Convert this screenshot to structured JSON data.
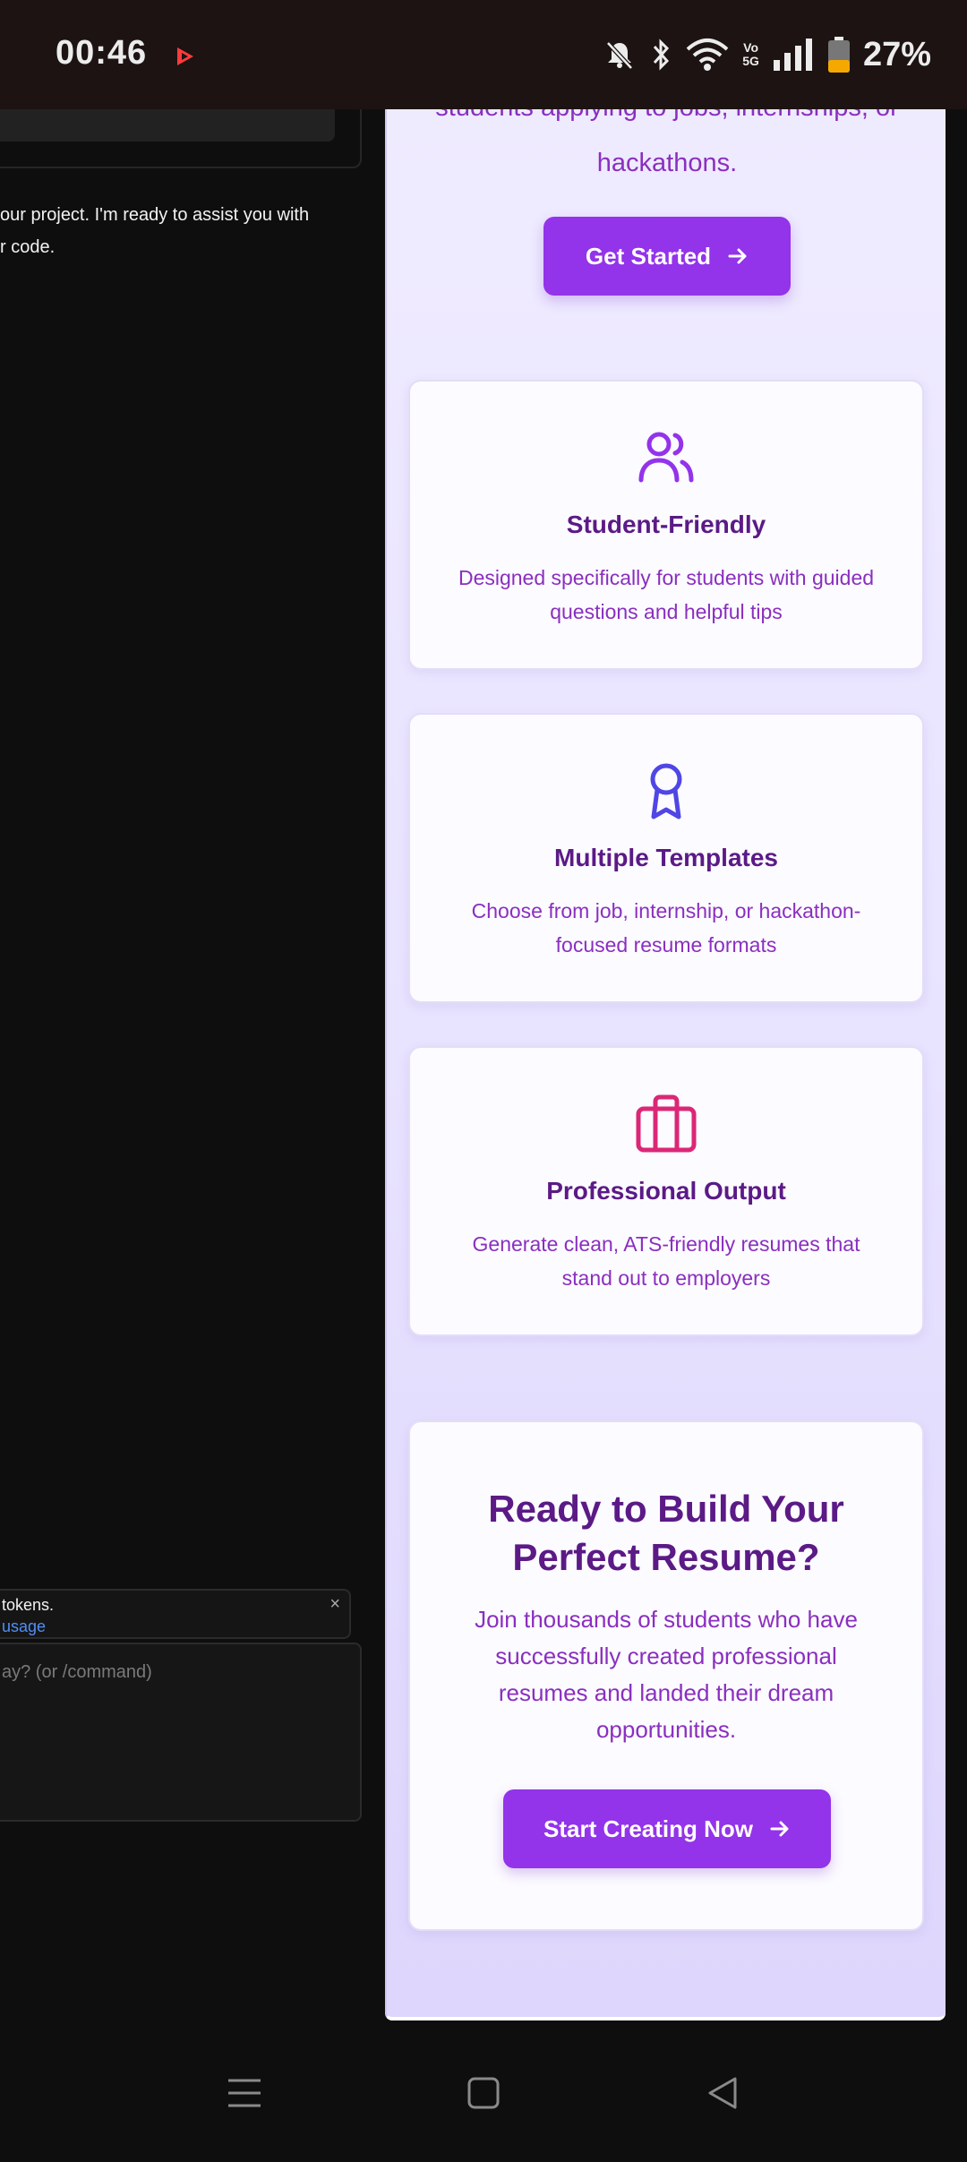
{
  "status_bar": {
    "time": "00:46",
    "battery_percent": "27%",
    "network_label_top": "Vo",
    "network_label_bottom": "5G",
    "icons": [
      "youtube-icon",
      "mute-icon",
      "bluetooth-icon",
      "wifi-icon",
      "signal-icon",
      "battery-icon"
    ]
  },
  "editor": {
    "assistant_message_line1": "our project. I'm ready to assist you with",
    "assistant_message_line2": "r code.",
    "notice_text": "tokens.",
    "notice_link": "usage",
    "notice_close": "×",
    "chat_placeholder": "ay? (or /command)"
  },
  "preview": {
    "hero_subtitle_line1": "students applying to jobs, internships, or",
    "hero_subtitle_line2": "hackathons.",
    "get_started_label": "Get Started",
    "features": [
      {
        "icon": "users-icon",
        "icon_color": "#9333ea",
        "title": "Student-Friendly",
        "description": "Designed specifically for students with guided questions and helpful tips"
      },
      {
        "icon": "award-icon",
        "icon_color": "#4f46e5",
        "title": "Multiple Templates",
        "description": "Choose from job, internship, or hackathon-focused resume formats"
      },
      {
        "icon": "briefcase-icon",
        "icon_color": "#db2777",
        "title": "Professional Output",
        "description": "Generate clean, ATS-friendly resumes that stand out to employers"
      }
    ],
    "cta": {
      "title": "Ready to Build Your Perfect Resume?",
      "text": "Join thousands of students who have successfully created professional resumes and landed their dream opportunities.",
      "button_label": "Start Creating Now"
    }
  },
  "nav_bar": {
    "buttons": [
      "recents-icon",
      "home-icon",
      "back-icon"
    ]
  },
  "colors": {
    "accent": "#9333ea",
    "heading": "#5b1a86",
    "body_text": "#8a2fbf"
  }
}
